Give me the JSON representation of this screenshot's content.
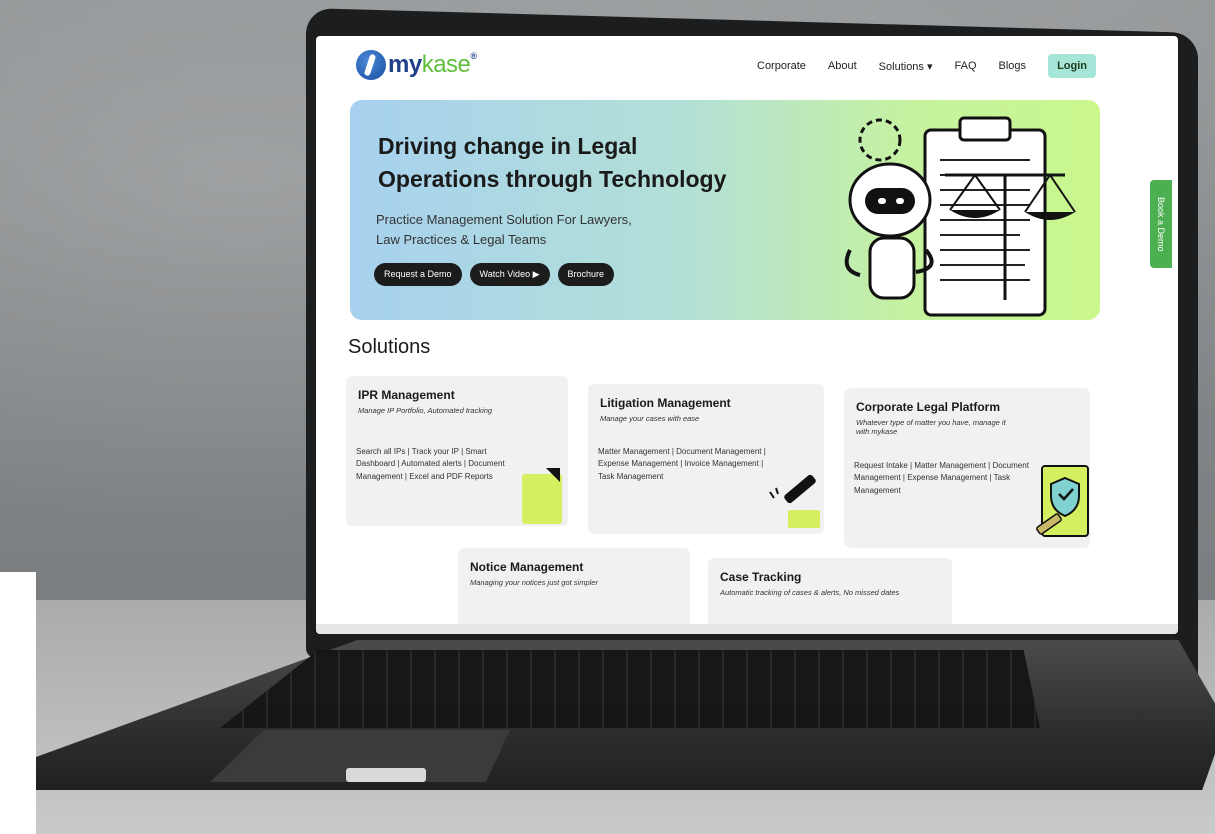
{
  "nav": {
    "logo_my": "my",
    "logo_kase": "kase",
    "logo_sup": "®",
    "links": [
      "Corporate",
      "About",
      "Solutions ▾",
      "FAQ",
      "Blogs"
    ],
    "login": "Login"
  },
  "hero": {
    "title_line1": "Driving change in Legal",
    "title_line2": "Operations through Technology",
    "sub_line1": "Practice Management Solution For Lawyers,",
    "sub_line2": "Law Practices & Legal Teams",
    "buttons": [
      "Request a Demo",
      "Watch Video ▶",
      "Brochure"
    ]
  },
  "book_demo": "Book a Demo",
  "solutions": {
    "title": "Solutions",
    "cards": [
      {
        "title": "IPR Management",
        "tagline": "Manage IP Portfolio, Automated tracking",
        "body": "Search all IPs | Track your IP | Smart Dashboard | Automated alerts | Document Management | Excel and PDF Reports"
      },
      {
        "title": "Litigation Management",
        "tagline": "Manage your cases with ease",
        "body": "Matter Management | Document Management | Expense Management | Invoice Management | Task Management"
      },
      {
        "title": "Corporate Legal Platform",
        "tagline": "Whatever type of matter you have, manage it with mykase",
        "body": "Request Intake | Matter Management | Document Management | Expense Management | Task Management"
      },
      {
        "title": "Notice Management",
        "tagline": "Managing your notices just got simpler",
        "body": ""
      },
      {
        "title": "Case Tracking",
        "tagline": "Automatic tracking of cases & alerts, No missed dates",
        "body": ""
      }
    ]
  },
  "colors": {
    "brand_blue": "#1f3f88",
    "brand_green": "#5fbf3a",
    "accent_lime": "#d4f061",
    "login_bg": "#a6e6d8",
    "book_demo_bg": "#4caf50"
  }
}
